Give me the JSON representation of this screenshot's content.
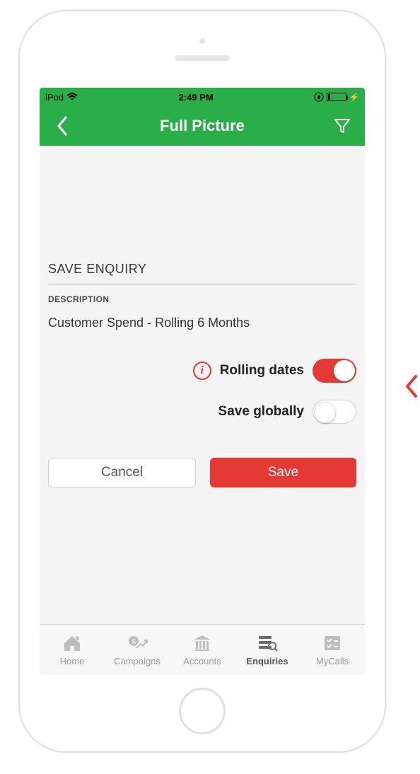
{
  "statusbar": {
    "device": "iPod",
    "time": "2:49 PM",
    "charging_glyph": "⚡"
  },
  "header": {
    "title": "Full Picture"
  },
  "panel": {
    "heading": "SAVE ENQUIRY",
    "description_label": "DESCRIPTION",
    "description_value": "Customer Spend - Rolling 6 Months",
    "rolling_label": "Rolling dates",
    "save_global_label": "Save globally",
    "toggles": {
      "rolling_dates": true,
      "save_globally": false
    }
  },
  "buttons": {
    "cancel": "Cancel",
    "save": "Save"
  },
  "tabs": {
    "items": [
      {
        "label": "Home"
      },
      {
        "label": "Campaigns"
      },
      {
        "label": "Accounts"
      },
      {
        "label": "Enquiries"
      },
      {
        "label": "MyCalls"
      }
    ],
    "active_index": 3
  },
  "colors": {
    "accent_green": "#2aae4a",
    "accent_red": "#E53935"
  }
}
